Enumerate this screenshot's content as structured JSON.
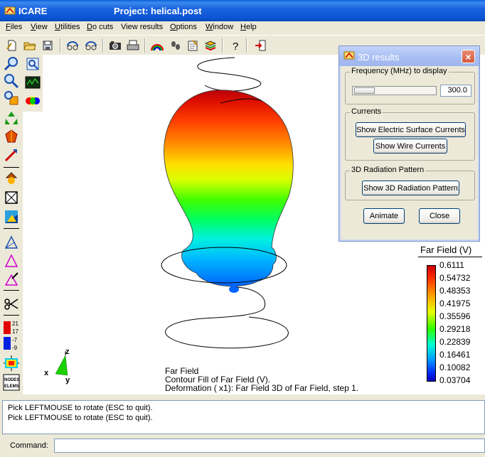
{
  "window": {
    "app_name": "ICARE",
    "project_title": "Project: helical.post"
  },
  "menu": [
    {
      "label": "Files",
      "mnemonic": "F"
    },
    {
      "label": "View",
      "mnemonic": "V"
    },
    {
      "label": "Utilities",
      "mnemonic": "U"
    },
    {
      "label": "Do cuts",
      "mnemonic": "D"
    },
    {
      "label": "View results",
      "mnemonic": ""
    },
    {
      "label": "Options",
      "mnemonic": "O"
    },
    {
      "label": "Window",
      "mnemonic": "W"
    },
    {
      "label": "Help",
      "mnemonic": "H"
    }
  ],
  "toolbar_icons": [
    "new-file-icon",
    "open-folder-icon",
    "save-icon",
    "rotate-left-icon",
    "rotate-right-icon",
    "camera-icon",
    "print-icon",
    "rainbow-icon",
    "footprints-icon",
    "notebook-icon",
    "layers-icon",
    "help-icon",
    "exit-icon"
  ],
  "left_toolbar_icons": [
    "zoom-in-icon",
    "zoom-out-icon",
    "zoom-box-icon",
    "recycle-icon",
    "shape-icon",
    "arrow-probe-icon",
    "lamp-icon",
    "bounding-box-icon",
    "3d-surface-icon",
    "wire-triangle-icon",
    "triangle-icon",
    "edit-triangle-icon",
    "scissors-icon",
    "value-range-icon",
    "contour-icon",
    "nodes-elems-icon"
  ],
  "left_toolbar2_icons": [
    "zoom-region-icon",
    "oscilloscope-icon",
    "color-rainbow-icon"
  ],
  "value_range": {
    "values": [
      "21",
      "17",
      "-7",
      "-9"
    ],
    "label": "NODES ELEMS"
  },
  "caption": {
    "line1": "Far Field",
    "line2": "Contour Fill of Far Field (V).",
    "line3": "Deformation ( x1): Far Field 3D of Far Field, step 1."
  },
  "axes": {
    "x": "x",
    "y": "y",
    "z": "z"
  },
  "legend": {
    "title": "Far Field (V)",
    "values": [
      "0.6111",
      "0.54732",
      "0.48353",
      "0.41975",
      "0.35596",
      "0.29218",
      "0.22839",
      "0.16461",
      "0.10082",
      "0.03704"
    ]
  },
  "status": {
    "lines": [
      "Pick LEFTMOUSE to rotate (ESC to quit).",
      "Pick LEFTMOUSE to rotate (ESC to quit)."
    ]
  },
  "command": {
    "label": "Command:",
    "value": ""
  },
  "dialog": {
    "title": "3D results",
    "frequency": {
      "label": "Frequency (MHz) to display",
      "value": "300.0"
    },
    "currents": {
      "label": "Currents",
      "surface_btn": "Show Electric Surface Currents",
      "wire_btn": "Show Wire Currents"
    },
    "radiation": {
      "label": "3D Radiation Pattern",
      "show_btn": "Show 3D Radiation Pattern"
    },
    "animate_btn": "Animate",
    "close_btn": "Close"
  },
  "colors": {
    "titlebar": "#0c54d2",
    "pattern_top": "#c8000a",
    "pattern_mid": "#2bff00",
    "pattern_bottom": "#0082ff"
  }
}
